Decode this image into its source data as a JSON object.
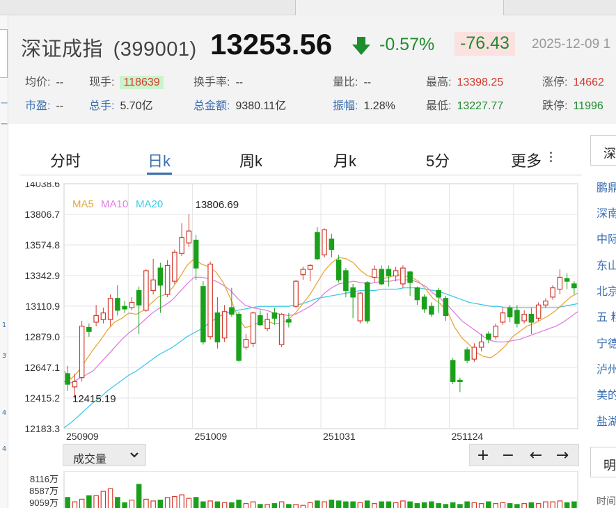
{
  "header": {
    "name": "深证成指",
    "code": "(399001)",
    "price": "13253.56",
    "change_pct": "-0.57%",
    "change_abs": "-76.43",
    "date": "2025-12-09 1"
  },
  "stats_row1": [
    {
      "label": "均价:",
      "value": "--",
      "style": ""
    },
    {
      "label": "现手:",
      "value": "118639",
      "style": "hl"
    },
    {
      "label": "换手率:",
      "value": "--",
      "style": ""
    },
    {
      "label": "量比:",
      "value": "--",
      "style": ""
    },
    {
      "label": "最高:",
      "value": "13398.25",
      "style": "red"
    },
    {
      "label": "涨停:",
      "value": "14662",
      "style": "red"
    }
  ],
  "stats_row2": [
    {
      "label": "市盈:",
      "value": "--",
      "style": "",
      "link": true
    },
    {
      "label": "总手:",
      "value": "5.70亿",
      "style": "",
      "link": true
    },
    {
      "label": "总金额:",
      "value": "9380.11亿",
      "style": "",
      "link": true
    },
    {
      "label": "振幅:",
      "value": "1.28%",
      "style": "",
      "link": true
    },
    {
      "label": "最低:",
      "value": "13227.77",
      "style": "green"
    },
    {
      "label": "跌停:",
      "value": "11996",
      "style": "green"
    }
  ],
  "tabs": [
    {
      "label": "分时",
      "active": false
    },
    {
      "label": "日k",
      "active": true
    },
    {
      "label": "周k",
      "active": false
    },
    {
      "label": "月k",
      "active": false
    },
    {
      "label": "5分",
      "active": false
    },
    {
      "label": "更多",
      "active": false
    }
  ],
  "legend": [
    {
      "label": "MA5",
      "color": "#e8a73a"
    },
    {
      "label": "MA10",
      "color": "#e07ee0"
    },
    {
      "label": "MA20",
      "color": "#3ec9e6"
    }
  ],
  "chart_data": {
    "type": "candlestick",
    "y_ticks": [
      "14038.6",
      "13806.7",
      "13574.8",
      "13342.9",
      "13110.9",
      "12879.0",
      "12647.1",
      "12415.2",
      "12183.3"
    ],
    "ylim": [
      12183.3,
      14038.6
    ],
    "x_ticks": [
      {
        "index": 0,
        "label": "250909"
      },
      {
        "index": 9,
        "label": "251009"
      },
      {
        "index": 18,
        "label": "251031"
      },
      {
        "index": 27,
        "label": "251124"
      }
    ],
    "annotations": [
      {
        "label": "13806.69",
        "index": 9,
        "value": 13806.69
      },
      {
        "label": "12415.19",
        "index": 0,
        "value": 12415.19
      }
    ],
    "up_color": "#d33a2c",
    "down_color": "#1aa01a",
    "candles": [
      {
        "o": 12600,
        "c": 12520,
        "h": 12660,
        "l": 12470
      },
      {
        "o": 12500,
        "c": 12540,
        "h": 12600,
        "l": 12415
      },
      {
        "o": 12570,
        "c": 12960,
        "h": 13000,
        "l": 12540
      },
      {
        "o": 12950,
        "c": 12920,
        "h": 12980,
        "l": 12880
      },
      {
        "o": 12990,
        "c": 13040,
        "h": 13120,
        "l": 12960
      },
      {
        "o": 13010,
        "c": 13060,
        "h": 13100,
        "l": 12980
      },
      {
        "o": 13010,
        "c": 13170,
        "h": 13200,
        "l": 12960
      },
      {
        "o": 13170,
        "c": 13080,
        "h": 13270,
        "l": 13040
      },
      {
        "o": 13110,
        "c": 13090,
        "h": 13150,
        "l": 13060
      },
      {
        "o": 13100,
        "c": 13140,
        "h": 13180,
        "l": 13080
      },
      {
        "o": 13230,
        "c": 13120,
        "h": 13260,
        "l": 12900
      },
      {
        "o": 13080,
        "c": 13380,
        "h": 13390,
        "l": 13070
      },
      {
        "o": 13230,
        "c": 13310,
        "h": 13470,
        "l": 13200
      },
      {
        "o": 13400,
        "c": 13270,
        "h": 13440,
        "l": 13060
      },
      {
        "o": 13200,
        "c": 13420,
        "h": 13460,
        "l": 13180
      },
      {
        "o": 13300,
        "c": 13520,
        "h": 13540,
        "l": 13280
      },
      {
        "o": 13510,
        "c": 13630,
        "h": 13740,
        "l": 13490
      },
      {
        "o": 13590,
        "c": 13680,
        "h": 13806,
        "l": 13560
      },
      {
        "o": 13610,
        "c": 13400,
        "h": 13650,
        "l": 13310
      },
      {
        "o": 13260,
        "c": 12840,
        "h": 13300,
        "l": 12820
      },
      {
        "o": 12880,
        "c": 13430,
        "h": 13450,
        "l": 12860
      },
      {
        "o": 13060,
        "c": 12840,
        "h": 13180,
        "l": 12790
      },
      {
        "o": 12870,
        "c": 13070,
        "h": 13120,
        "l": 12840
      },
      {
        "o": 13100,
        "c": 13050,
        "h": 13250,
        "l": 13030
      },
      {
        "o": 13050,
        "c": 12700,
        "h": 13070,
        "l": 12690
      },
      {
        "o": 12800,
        "c": 12860,
        "h": 12900,
        "l": 12780
      },
      {
        "o": 12830,
        "c": 13060,
        "h": 13070,
        "l": 12800
      },
      {
        "o": 13040,
        "c": 12970,
        "h": 13080,
        "l": 12960
      },
      {
        "o": 12940,
        "c": 13010,
        "h": 13060,
        "l": 12920
      },
      {
        "o": 13060,
        "c": 13020,
        "h": 13100,
        "l": 12970
      },
      {
        "o": 12820,
        "c": 13050,
        "h": 13060,
        "l": 12800
      },
      {
        "o": 13010,
        "c": 12990,
        "h": 13060,
        "l": 12950
      },
      {
        "o": 13110,
        "c": 13300,
        "h": 13310,
        "l": 13100
      },
      {
        "o": 13350,
        "c": 13390,
        "h": 13410,
        "l": 13310
      },
      {
        "o": 13390,
        "c": 13420,
        "h": 13430,
        "l": 13300
      },
      {
        "o": 13670,
        "c": 13470,
        "h": 13710,
        "l": 13460
      },
      {
        "o": 13500,
        "c": 13690,
        "h": 13700,
        "l": 13480
      },
      {
        "o": 13620,
        "c": 13540,
        "h": 13660,
        "l": 13480
      },
      {
        "o": 13460,
        "c": 13310,
        "h": 13500,
        "l": 13290
      },
      {
        "o": 13380,
        "c": 13230,
        "h": 13400,
        "l": 13180
      },
      {
        "o": 13250,
        "c": 13180,
        "h": 13280,
        "l": 13020
      },
      {
        "o": 13000,
        "c": 13210,
        "h": 13220,
        "l": 12980
      },
      {
        "o": 13290,
        "c": 13000,
        "h": 13300,
        "l": 12980
      },
      {
        "o": 13330,
        "c": 13390,
        "h": 13420,
        "l": 13290
      },
      {
        "o": 13390,
        "c": 13280,
        "h": 13420,
        "l": 13270
      },
      {
        "o": 13390,
        "c": 13340,
        "h": 13420,
        "l": 13260
      },
      {
        "o": 13340,
        "c": 13380,
        "h": 13410,
        "l": 13300
      },
      {
        "o": 13280,
        "c": 13400,
        "h": 13420,
        "l": 13250
      },
      {
        "o": 13370,
        "c": 13290,
        "h": 13380,
        "l": 13190
      },
      {
        "o": 13250,
        "c": 13160,
        "h": 13260,
        "l": 13120
      },
      {
        "o": 13180,
        "c": 13090,
        "h": 13200,
        "l": 13060
      },
      {
        "o": 13110,
        "c": 13050,
        "h": 13140,
        "l": 13030
      },
      {
        "o": 13230,
        "c": 13180,
        "h": 13250,
        "l": 13060
      },
      {
        "o": 13170,
        "c": 13040,
        "h": 13190,
        "l": 13000
      },
      {
        "o": 12700,
        "c": 12540,
        "h": 12720,
        "l": 12520
      },
      {
        "o": 12550,
        "c": 12540,
        "h": 12570,
        "l": 12460
      },
      {
        "o": 12780,
        "c": 12700,
        "h": 12800,
        "l": 12680
      },
      {
        "o": 12710,
        "c": 12800,
        "h": 12830,
        "l": 12690
      },
      {
        "o": 12800,
        "c": 12840,
        "h": 12900,
        "l": 12770
      },
      {
        "o": 12900,
        "c": 12860,
        "h": 12920,
        "l": 12830
      },
      {
        "o": 12880,
        "c": 12960,
        "h": 12980,
        "l": 12860
      },
      {
        "o": 12990,
        "c": 13060,
        "h": 13100,
        "l": 12970
      },
      {
        "o": 13100,
        "c": 13030,
        "h": 13120,
        "l": 12990
      },
      {
        "o": 13080,
        "c": 12980,
        "h": 13120,
        "l": 12950
      },
      {
        "o": 13000,
        "c": 13050,
        "h": 13080,
        "l": 12980
      },
      {
        "o": 13050,
        "c": 12990,
        "h": 13100,
        "l": 12900
      },
      {
        "o": 13020,
        "c": 13120,
        "h": 13140,
        "l": 13000
      },
      {
        "o": 13120,
        "c": 13150,
        "h": 13170,
        "l": 13100
      },
      {
        "o": 13180,
        "c": 13250,
        "h": 13270,
        "l": 13160
      },
      {
        "o": 13240,
        "c": 13330,
        "h": 13390,
        "l": 13200
      },
      {
        "o": 13320,
        "c": 13300,
        "h": 13360,
        "l": 13240
      },
      {
        "o": 13280,
        "c": 13250,
        "h": 13300,
        "l": 13200
      }
    ],
    "ma5": [
      12620,
      12560,
      12620,
      12700,
      12780,
      12850,
      12930,
      12990,
      13020,
      13060,
      13050,
      13080,
      13130,
      13180,
      13200,
      13250,
      13330,
      13420,
      13470,
      13430,
      13410,
      13370,
      13290,
      13170,
      13030,
      12950,
      12960,
      12990,
      13000,
      12980,
      12980,
      13010,
      13060,
      13130,
      13200,
      13290,
      13380,
      13440,
      13480,
      13470,
      13440,
      13380,
      13340,
      13330,
      13320,
      13330,
      13350,
      13340,
      13330,
      13300,
      13240,
      13170,
      13130,
      13070,
      12950,
      12870,
      12820,
      12760,
      12730,
      12720,
      12760,
      12810,
      12880,
      12920,
      12960,
      12980,
      13010,
      13040,
      13080,
      13130,
      13180,
      13210
    ],
    "ma10": [
      12540,
      12530,
      12560,
      12590,
      12620,
      12680,
      12740,
      12800,
      12860,
      12910,
      12950,
      13000,
      13050,
      13090,
      13120,
      13160,
      13220,
      13280,
      13330,
      13330,
      13320,
      13300,
      13270,
      13230,
      13170,
      13120,
      13100,
      13090,
      13080,
      13060,
      13050,
      13040,
      13050,
      13080,
      13110,
      13150,
      13210,
      13250,
      13280,
      13290,
      13300,
      13290,
      13280,
      13290,
      13300,
      13300,
      13310,
      13310,
      13310,
      13290,
      13260,
      13210,
      13170,
      13120,
      13060,
      13000,
      12960,
      12920,
      12880,
      12850,
      12840,
      12840,
      12850,
      12860,
      12880,
      12900,
      12920,
      12940,
      12960,
      12990,
      13030,
      13070
    ],
    "ma20": [
      12190,
      12230,
      12280,
      12330,
      12380,
      12420,
      12470,
      12510,
      12550,
      12590,
      12620,
      12660,
      12700,
      12740,
      12770,
      12800,
      12840,
      12880,
      12910,
      12940,
      12980,
      13020,
      13050,
      13070,
      13080,
      13090,
      13100,
      13110,
      13110,
      13110,
      13110,
      13110,
      13120,
      13130,
      13150,
      13170,
      13180,
      13190,
      13200,
      13210,
      13220,
      13230,
      13230,
      13230,
      13240,
      13240,
      13240,
      13250,
      13250,
      13250,
      13240,
      13230,
      13220,
      13200,
      13180,
      13160,
      13140,
      13130,
      13120,
      13110,
      13110,
      13100,
      13100,
      13100,
      13100,
      13100,
      13100,
      13100,
      13100,
      13110,
      13120,
      13130
    ],
    "volume": [
      40,
      30,
      36,
      44,
      44,
      54,
      60,
      40,
      28,
      34,
      70,
      36,
      32,
      34,
      40,
      42,
      46,
      38,
      40,
      30,
      32,
      30,
      28,
      28,
      34,
      26,
      30,
      24,
      24,
      26,
      30,
      24,
      24,
      22,
      28,
      32,
      30,
      34,
      32,
      30,
      30,
      28,
      32,
      26,
      30,
      30,
      28,
      32,
      30,
      26,
      28,
      30,
      26,
      24,
      28,
      24,
      30,
      28,
      26,
      30,
      26,
      28,
      26,
      24,
      26,
      28,
      26,
      30,
      30,
      32,
      28,
      30
    ],
    "volume_ticks": [
      "8116万",
      "8587万",
      "9059万"
    ]
  },
  "vol_select": {
    "label": "成交量"
  },
  "controls": [
    "+",
    "−",
    "←",
    "→"
  ],
  "right_panel": {
    "header": "深",
    "items": [
      "鹏鼎",
      "深南",
      "中际",
      "东山",
      "北京",
      "五 粮",
      "宁德",
      "泸州",
      "美的",
      "盐湖"
    ],
    "header2": "明",
    "sub": "时间"
  },
  "left_nav": [
    "一",
    "一",
    "1",
    "3",
    "4",
    "4"
  ]
}
